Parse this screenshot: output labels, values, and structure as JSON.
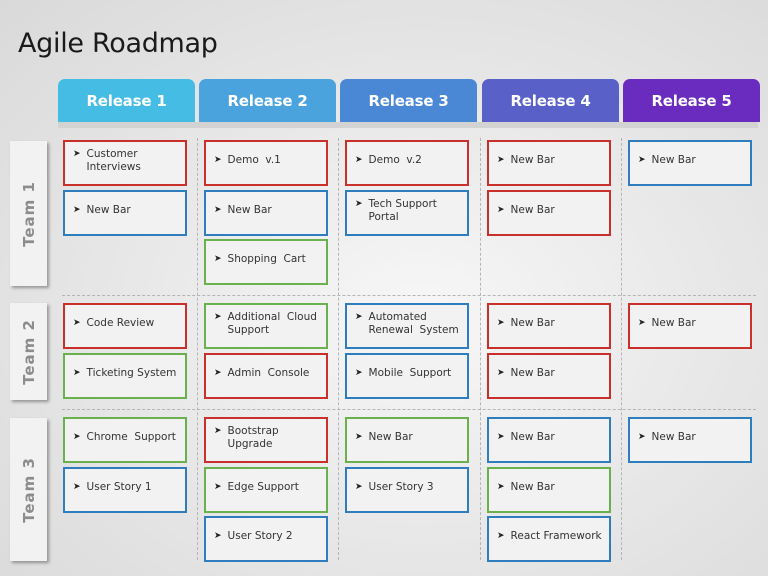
{
  "title": "Agile Roadmap",
  "releases": [
    {
      "label": "Release 1",
      "color": "#45bce3"
    },
    {
      "label": "Release 2",
      "color": "#4aa3dc"
    },
    {
      "label": "Release 3",
      "color": "#4a88d6"
    },
    {
      "label": "Release 4",
      "color": "#5960c8"
    },
    {
      "label": "Release 5",
      "color": "#6a2bbf"
    }
  ],
  "teams": [
    {
      "label": "Team 1"
    },
    {
      "label": "Team 2"
    },
    {
      "label": "Team 3"
    }
  ],
  "status_colors": {
    "red": "#c9302c",
    "blue": "#2e7dbf",
    "green": "#6ab04c"
  },
  "arrow_glyph": "➤",
  "cards": [
    {
      "team": 0,
      "release": 0,
      "slot": 0,
      "text": "Customer Interviews",
      "color": "red"
    },
    {
      "team": 0,
      "release": 0,
      "slot": 1,
      "text": "New Bar",
      "color": "blue"
    },
    {
      "team": 0,
      "release": 1,
      "slot": 0,
      "text": "Demo  v.1",
      "color": "red"
    },
    {
      "team": 0,
      "release": 1,
      "slot": 1,
      "text": "New Bar",
      "color": "blue"
    },
    {
      "team": 0,
      "release": 1,
      "slot": 2,
      "text": "Shopping  Cart",
      "color": "green"
    },
    {
      "team": 0,
      "release": 2,
      "slot": 0,
      "text": "Demo  v.2",
      "color": "red"
    },
    {
      "team": 0,
      "release": 2,
      "slot": 1,
      "text": "Tech Support Portal",
      "color": "blue"
    },
    {
      "team": 0,
      "release": 3,
      "slot": 0,
      "text": "New Bar",
      "color": "red"
    },
    {
      "team": 0,
      "release": 3,
      "slot": 1,
      "text": "New Bar",
      "color": "red"
    },
    {
      "team": 0,
      "release": 4,
      "slot": 0,
      "text": "New Bar",
      "color": "blue"
    },
    {
      "team": 1,
      "release": 0,
      "slot": 0,
      "text": "Code Review",
      "color": "red"
    },
    {
      "team": 1,
      "release": 0,
      "slot": 1,
      "text": "Ticketing System",
      "color": "green"
    },
    {
      "team": 1,
      "release": 1,
      "slot": 0,
      "text": "Additional  Cloud Support",
      "color": "green"
    },
    {
      "team": 1,
      "release": 1,
      "slot": 1,
      "text": "Admin  Console",
      "color": "red"
    },
    {
      "team": 1,
      "release": 2,
      "slot": 0,
      "text": "Automated Renewal  System",
      "color": "blue"
    },
    {
      "team": 1,
      "release": 2,
      "slot": 1,
      "text": "Mobile  Support",
      "color": "blue"
    },
    {
      "team": 1,
      "release": 3,
      "slot": 0,
      "text": "New Bar",
      "color": "red"
    },
    {
      "team": 1,
      "release": 3,
      "slot": 1,
      "text": "New Bar",
      "color": "red"
    },
    {
      "team": 1,
      "release": 4,
      "slot": 0,
      "text": "New Bar",
      "color": "red"
    },
    {
      "team": 2,
      "release": 0,
      "slot": 0,
      "text": "Chrome  Support",
      "color": "green"
    },
    {
      "team": 2,
      "release": 0,
      "slot": 1,
      "text": "User Story 1",
      "color": "blue"
    },
    {
      "team": 2,
      "release": 1,
      "slot": 0,
      "text": "Bootstrap Upgrade",
      "color": "red"
    },
    {
      "team": 2,
      "release": 1,
      "slot": 1,
      "text": "Edge Support",
      "color": "green"
    },
    {
      "team": 2,
      "release": 1,
      "slot": 2,
      "text": "User Story 2",
      "color": "blue"
    },
    {
      "team": 2,
      "release": 2,
      "slot": 0,
      "text": "New Bar",
      "color": "green"
    },
    {
      "team": 2,
      "release": 2,
      "slot": 1,
      "text": "User Story 3",
      "color": "blue"
    },
    {
      "team": 2,
      "release": 3,
      "slot": 0,
      "text": "New Bar",
      "color": "blue"
    },
    {
      "team": 2,
      "release": 3,
      "slot": 1,
      "text": "New Bar",
      "color": "green"
    },
    {
      "team": 2,
      "release": 3,
      "slot": 2,
      "text": "React Framework",
      "color": "blue"
    },
    {
      "team": 2,
      "release": 4,
      "slot": 0,
      "text": "New Bar",
      "color": "blue"
    }
  ]
}
